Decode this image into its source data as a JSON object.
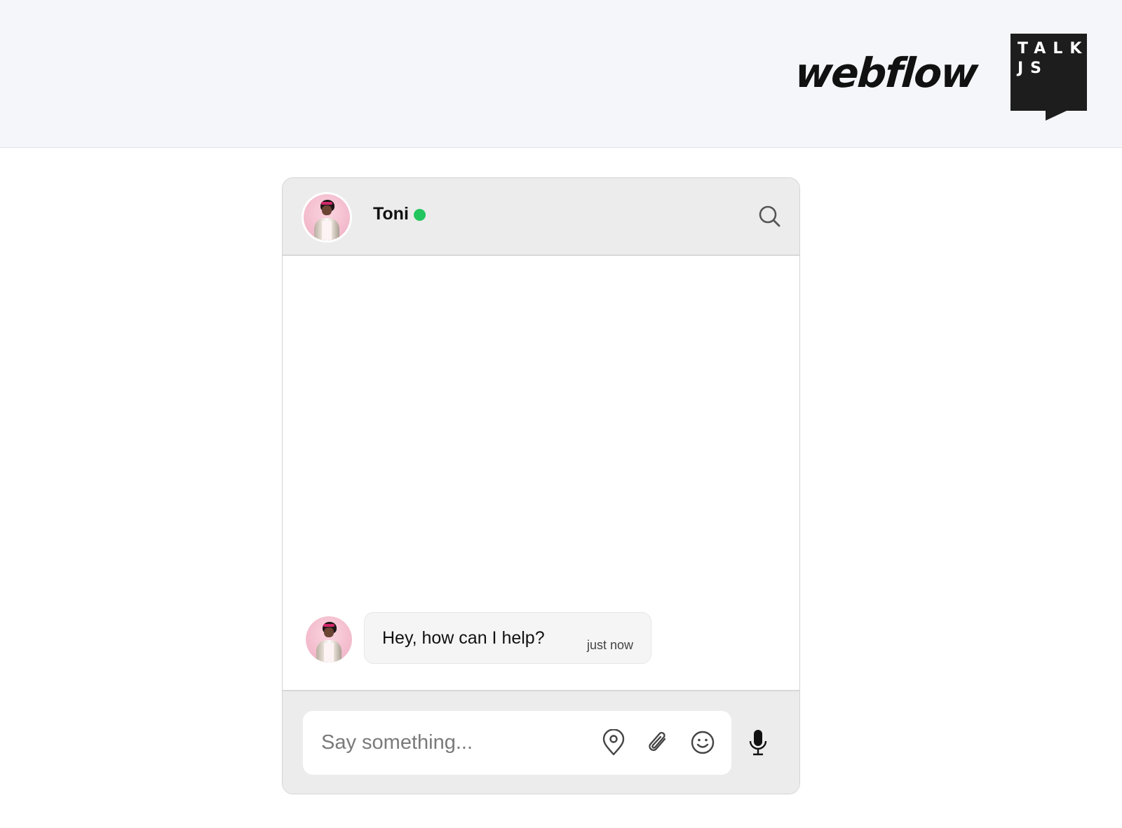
{
  "branding": {
    "webflow_logo": "webflow",
    "talkjs_logo": {
      "line1": "TALK",
      "line2": "JS"
    }
  },
  "chat": {
    "header": {
      "user_name": "Toni",
      "status": "online",
      "status_color": "#22c55e",
      "avatar_icon": "user-avatar-photo",
      "search_icon": "search-icon"
    },
    "messages": [
      {
        "sender": "Toni",
        "text": "Hey, how can I help?",
        "timestamp": "just now"
      }
    ],
    "composer": {
      "placeholder": "Say something...",
      "value": "",
      "icons": [
        "location-pin-icon",
        "paperclip-icon",
        "emoji-icon",
        "microphone-icon"
      ]
    }
  }
}
